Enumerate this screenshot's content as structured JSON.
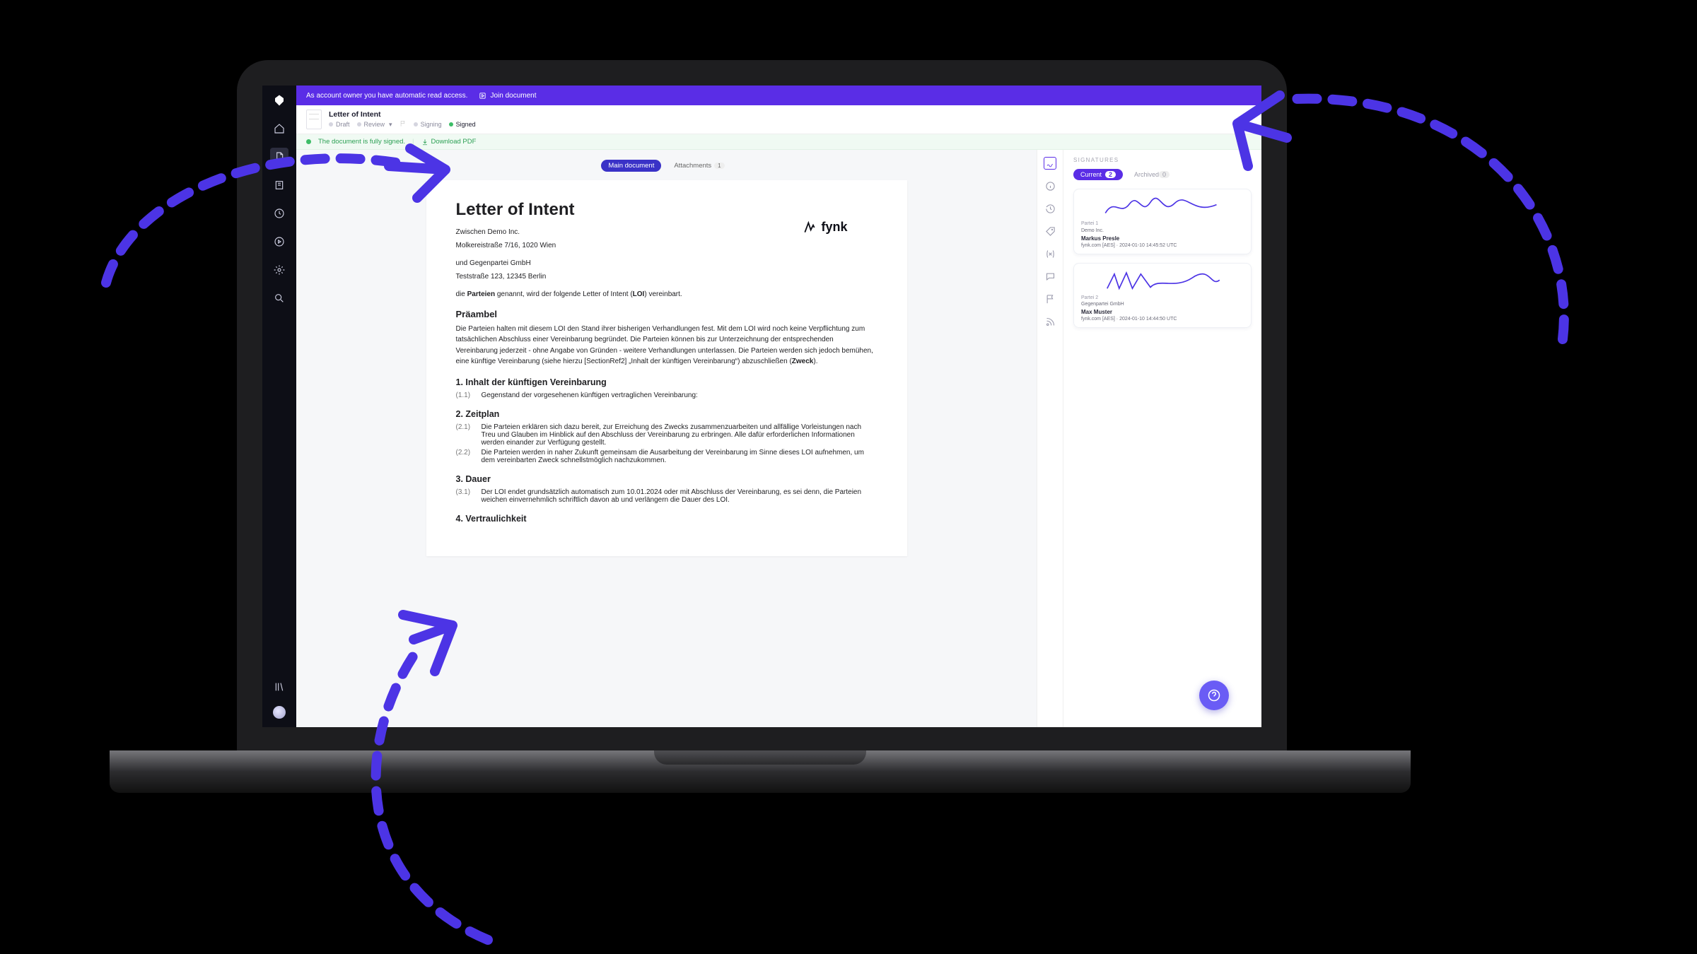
{
  "banner": {
    "owner_access": "As account owner you have automatic read access.",
    "join": "Join document"
  },
  "header": {
    "title": "Letter of Intent",
    "workflow": {
      "draft": "Draft",
      "review": "Review",
      "signing": "Signing",
      "signed": "Signed"
    }
  },
  "status": {
    "signed": "The document is fully signed.",
    "download": "Download PDF"
  },
  "tabs": {
    "main": "Main document",
    "attachments": "Attachments",
    "attachments_count": "1"
  },
  "doc": {
    "brand_name": "fynk",
    "h1": "Letter of Intent",
    "party_a1": "Zwischen Demo Inc.",
    "party_a2": "Molkereistraße 7/16, 1020 Wien",
    "party_b1": "und Gegenpartei GmbH",
    "party_b2": "Teststraße 123, 12345 Berlin",
    "intro_pre": "die ",
    "intro_bold1": "Parteien",
    "intro_mid": " genannt, wird der folgende Letter of Intent (",
    "intro_bold2": "LOI",
    "intro_post": ") vereinbart.",
    "preamble_h": "Präambel",
    "preamble_text": "Die Parteien halten mit diesem LOI den Stand ihrer bisherigen Verhandlungen fest. Mit dem LOI wird noch keine Verpflichtung zum tatsächlichen Abschluss einer Vereinbarung begründet. Die Parteien können bis zur Unterzeichnung der entsprechenden Vereinbarung jederzeit - ohne Angabe von Gründen - weitere Verhandlungen unterlassen. Die Parteien werden sich jedoch bemühen, eine künftige Vereinbarung (siehe hierzu [SectionRef2] „Inhalt der künftigen Vereinbarung“) abzuschließen (",
    "zweck": "Zweck",
    "preamble_end": ").",
    "s1_h": "1. Inhalt der künftigen Vereinbarung",
    "s1_1_num": "(1.1)",
    "s1_1": "Gegenstand der vorgesehenen künftigen vertraglichen Vereinbarung:",
    "s2_h": "2. Zeitplan",
    "s2_1_num": "(2.1)",
    "s2_1": "Die Parteien erklären sich dazu bereit, zur Erreichung des Zwecks zusammenzuarbeiten und allfällige Vorleistungen nach Treu und Glauben im Hinblick auf den Abschluss der Vereinbarung zu erbringen. Alle dafür erforderlichen Informationen werden einander zur Verfügung gestellt.",
    "s2_2_num": "(2.2)",
    "s2_2": "Die Parteien werden in naher Zukunft gemeinsam die Ausarbeitung der Vereinbarung im Sinne dieses LOI aufnehmen, um dem vereinbarten Zweck schnellstmöglich nachzukommen.",
    "s3_h": "3. Dauer",
    "s3_1_num": "(3.1)",
    "s3_1": "Der LOI endet grundsätzlich automatisch zum 10.01.2024 oder mit Abschluss der Vereinbarung, es sei denn, die Parteien weichen einvernehmlich schriftlich davon ab und verlängern die Dauer des LOI.",
    "s4_h": "4. Vertraulichkeit"
  },
  "side": {
    "title": "SIGNATURES",
    "tabs": {
      "current": "Current",
      "current_count": "2",
      "archived": "Archived",
      "archived_count": "0"
    },
    "cards": [
      {
        "party": "Partei 1",
        "company": "Demo Inc.",
        "name": "Markus Presle",
        "meta": "fynk.com [AES] · 2024-01-10 14:45:52 UTC"
      },
      {
        "party": "Partei 2",
        "company": "Gegenpartei GmbH",
        "name": "Max Muster",
        "meta": "fynk.com [AES] · 2024-01-10 14:44:50 UTC"
      }
    ]
  },
  "help_label": "Help"
}
